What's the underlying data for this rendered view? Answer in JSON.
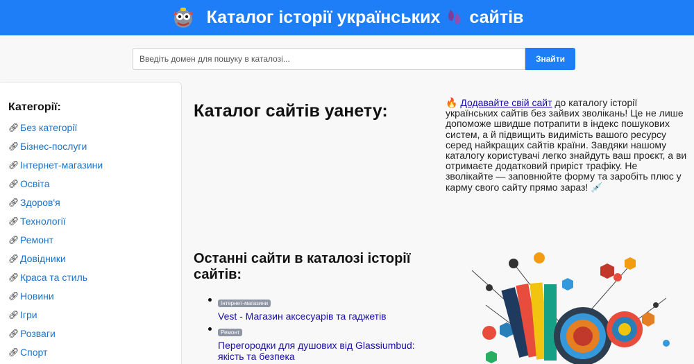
{
  "header": {
    "title_part1": "Каталог історії українських",
    "title_part2": "сайтів",
    "logo_icon": "mascot-logo-icon",
    "emoji_icon": "footprints-icon",
    "background_color": "#1e7ef7"
  },
  "search": {
    "placeholder": "Введіть домен для пошуку в каталозі...",
    "value": "",
    "button_label": "Знайти"
  },
  "sidebar": {
    "title": "Категорії:",
    "item_icon": "link-icon",
    "items": [
      {
        "label": "Без категорії"
      },
      {
        "label": "Бізнес-послуги"
      },
      {
        "label": "Інтернет-магазини"
      },
      {
        "label": "Освіта"
      },
      {
        "label": "Здоров'я"
      },
      {
        "label": "Технології"
      },
      {
        "label": "Ремонт"
      },
      {
        "label": "Довідники"
      },
      {
        "label": "Краса та стиль"
      },
      {
        "label": "Новини"
      },
      {
        "label": "Ігри"
      },
      {
        "label": "Розваги"
      },
      {
        "label": "Спорт"
      }
    ]
  },
  "main": {
    "title": "Каталог сайтів уанету:",
    "promo": {
      "fire_icon": "fire-icon",
      "link_text": "Додавайте свій сайт",
      "text": "до каталогу історії українських сайтів без зайвих зволікань! Це не лише допоможе швидше потрапити в індекс пошукових систем, а й підвищить видимість вашого ресурсу серед найкращих сайтів країни. Завдяки нашому каталогу користувачі легко знайдуть ваш проєкт, а ви отримаєте додатковий приріст трафіку. Не зволікайте — заповнюйте форму та заробіть плюс у карму свого сайту прямо зараз!",
      "end_icon": "syringe-icon"
    },
    "recent_title": "Останні сайти в каталозі історії сайтів:",
    "recent": [
      {
        "badge": "Інтернет-магазини",
        "title": "Vest - Магазин аксесуарів та гаджетів"
      },
      {
        "badge": "Ремонт",
        "title": "Перегородки для душових від Glassiumbud: якість та безпека"
      }
    ]
  }
}
